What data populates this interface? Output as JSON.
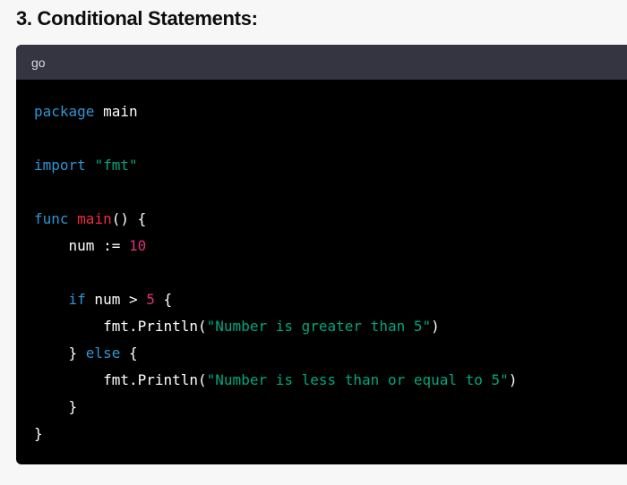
{
  "heading": "3. Conditional Statements:",
  "code_block": {
    "language": "go",
    "colors": {
      "keyword": "#2e95d3",
      "string": "#00a67d",
      "function_name": "#f22c3d",
      "number": "#df3079",
      "plain": "#ffffff",
      "header_bg": "#343541",
      "code_bg": "#000000"
    },
    "lines": [
      [
        {
          "t": "kw",
          "v": "package"
        },
        {
          "t": "pl",
          "v": " main"
        }
      ],
      [],
      [
        {
          "t": "kw",
          "v": "import"
        },
        {
          "t": "pl",
          "v": " "
        },
        {
          "t": "str",
          "v": "\"fmt\""
        }
      ],
      [],
      [
        {
          "t": "kw",
          "v": "func"
        },
        {
          "t": "pl",
          "v": " "
        },
        {
          "t": "fn",
          "v": "main"
        },
        {
          "t": "pl",
          "v": "() {"
        }
      ],
      [
        {
          "t": "pl",
          "v": "    num := "
        },
        {
          "t": "num",
          "v": "10"
        }
      ],
      [],
      [
        {
          "t": "pl",
          "v": "    "
        },
        {
          "t": "kw",
          "v": "if"
        },
        {
          "t": "pl",
          "v": " num > "
        },
        {
          "t": "num",
          "v": "5"
        },
        {
          "t": "pl",
          "v": " {"
        }
      ],
      [
        {
          "t": "pl",
          "v": "        fmt.Println("
        },
        {
          "t": "str",
          "v": "\"Number is greater than 5\""
        },
        {
          "t": "pl",
          "v": ")"
        }
      ],
      [
        {
          "t": "pl",
          "v": "    } "
        },
        {
          "t": "kw",
          "v": "else"
        },
        {
          "t": "pl",
          "v": " {"
        }
      ],
      [
        {
          "t": "pl",
          "v": "        fmt.Println("
        },
        {
          "t": "str",
          "v": "\"Number is less than or equal to 5\""
        },
        {
          "t": "pl",
          "v": ")"
        }
      ],
      [
        {
          "t": "pl",
          "v": "    }"
        }
      ],
      [
        {
          "t": "pl",
          "v": "}"
        }
      ]
    ]
  }
}
